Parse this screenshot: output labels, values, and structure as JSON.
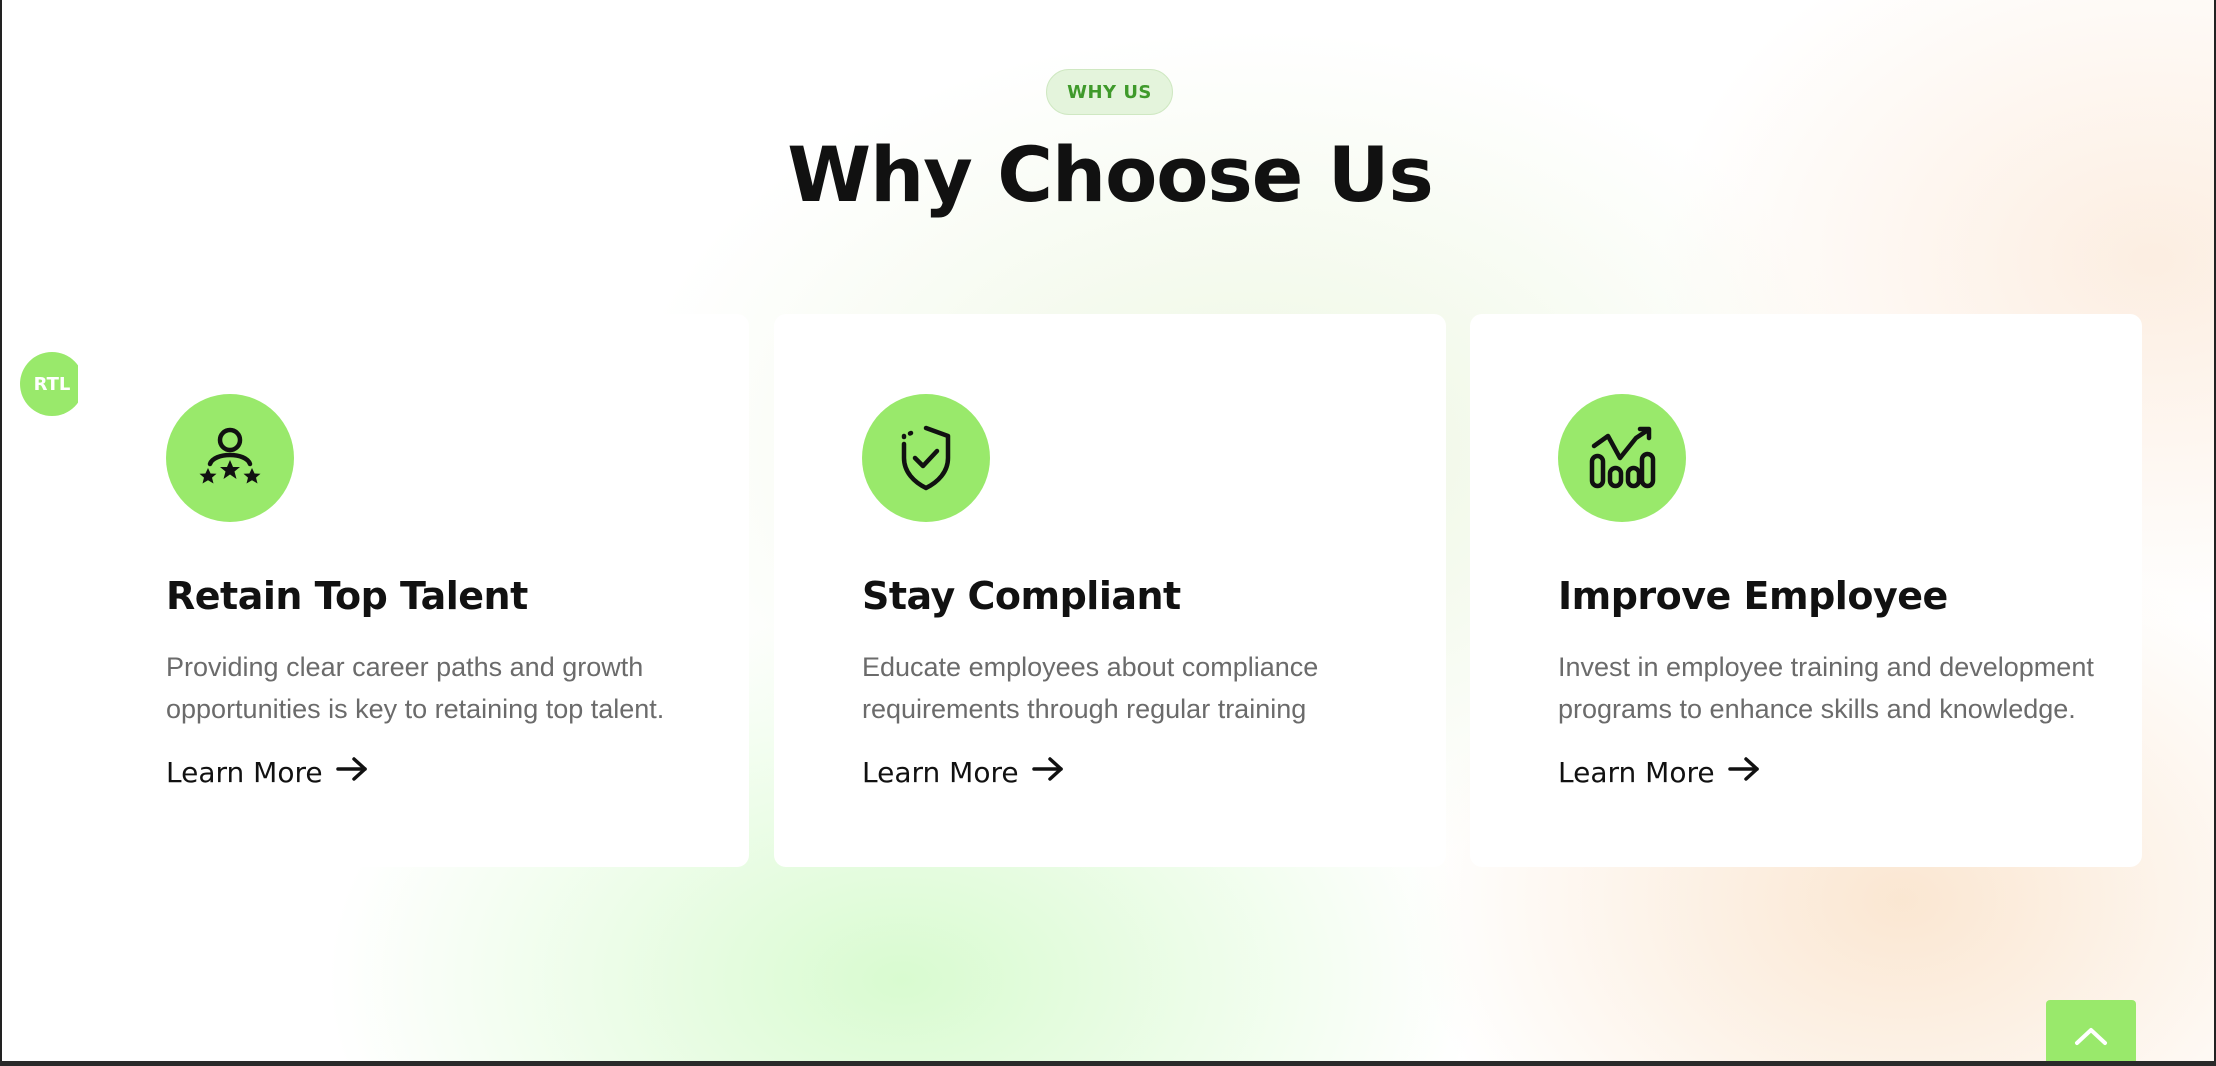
{
  "section": {
    "badge": "WHY US",
    "title": "Why Choose Us"
  },
  "rtl_toggle": {
    "label": "RTL"
  },
  "cards": [
    {
      "icon": "user-stars-icon",
      "title": "Retain Top Talent",
      "description": "Providing clear career paths and growth opportunities is key to retaining top talent.",
      "link_label": "Learn More"
    },
    {
      "icon": "shield-check-icon",
      "title": "Stay Compliant",
      "description": "Educate employees about compliance requirements through regular training",
      "link_label": "Learn More"
    },
    {
      "icon": "growth-chart-icon",
      "title": "Improve Employee",
      "description": "Invest in employee training and development programs to enhance skills and knowledge.",
      "link_label": "Learn More"
    }
  ],
  "scroll_top": {
    "icon": "chevron-up-icon"
  },
  "colors": {
    "accent": "#99e96b",
    "badge_text": "#3f9a2b",
    "heading": "#111111",
    "body_text": "#6b6b6b"
  }
}
